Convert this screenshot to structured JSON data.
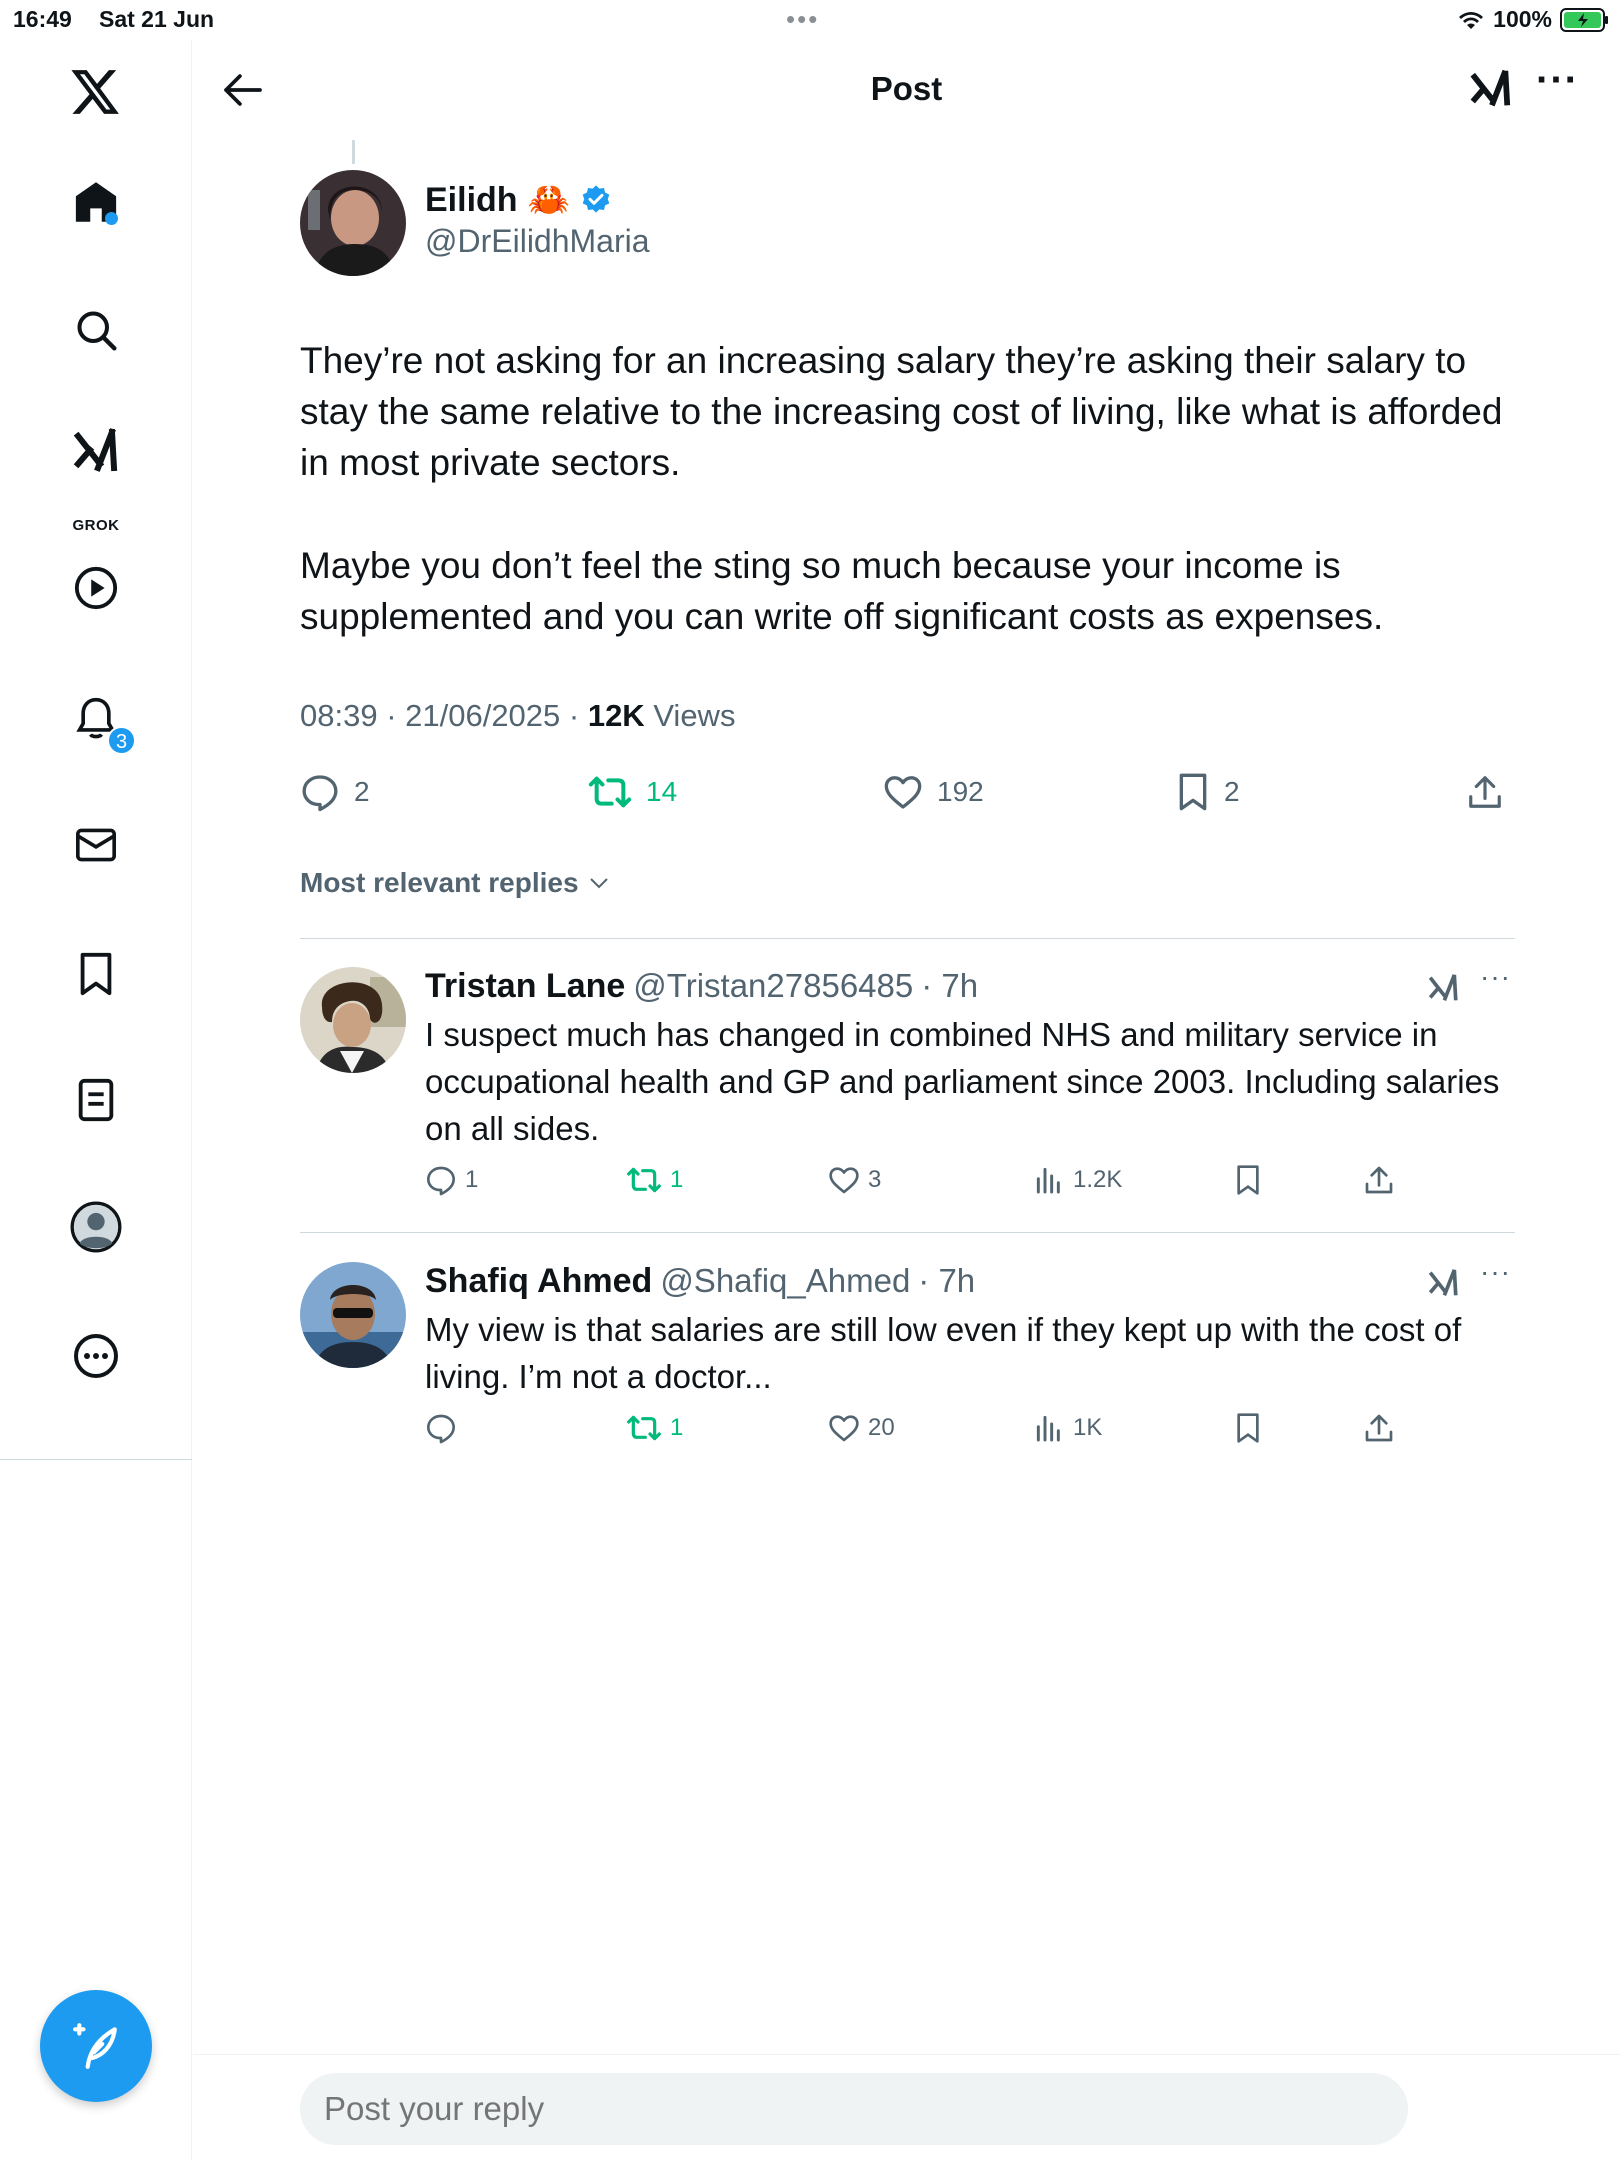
{
  "status_bar": {
    "time": "16:49",
    "date": "Sat 21 Jun",
    "battery": "100%"
  },
  "sidebar": {
    "items": [
      {
        "name": "home-icon"
      },
      {
        "name": "search-icon"
      },
      {
        "name": "grok-icon",
        "label": "GROK"
      },
      {
        "name": "video-icon"
      },
      {
        "name": "notifications-icon",
        "badge": "3"
      },
      {
        "name": "messages-icon"
      },
      {
        "name": "bookmarks-icon"
      },
      {
        "name": "lists-icon"
      },
      {
        "name": "profile-icon"
      },
      {
        "name": "more-icon"
      }
    ],
    "compose_icon": "compose-post-icon"
  },
  "header": {
    "title": "Post"
  },
  "post": {
    "author_name": "Eilidh",
    "author_emoji": "🦀",
    "author_handle": "@DrEilidhMaria",
    "text_p1": "They’re not asking for an increasing salary they’re asking their salary to stay the same relative to the increasing cost of living, like what is afforded in most private sectors.",
    "text_p2": "Maybe you don’t feel the sting so much because your income is supplemented and you can write off significant costs as expenses.",
    "timestamp": "08:39 · 21/06/2025 · ",
    "views_count": "12K",
    "views_label": " Views",
    "replies": "2",
    "reposts": "14",
    "likes": "192",
    "bookmarks": "2"
  },
  "sort_label": "Most relevant replies",
  "replies": [
    {
      "name": "Tristan Lane",
      "handle": "@Tristan27856485",
      "time": "· 7h",
      "text": "I suspect much has changed in combined NHS and military service in occupational health and GP and parliament since 2003. Including salaries on all sides.",
      "replies": "1",
      "reposts": "1",
      "likes": "3",
      "views": "1.2K"
    },
    {
      "name": "Shafiq Ahmed",
      "handle": "@Shafiq_Ahmed",
      "time": "· 7h",
      "text": "My view is that salaries are still low even if they kept up with the cost of living. I’m not a doctor...",
      "replies": "",
      "reposts": "1",
      "likes": "20",
      "views": "1K"
    }
  ],
  "reply_box": {
    "placeholder": "Post your reply"
  },
  "colors": {
    "accent": "#1d9bf0",
    "repost_green": "#00ba7c",
    "secondary_text": "#536471"
  }
}
